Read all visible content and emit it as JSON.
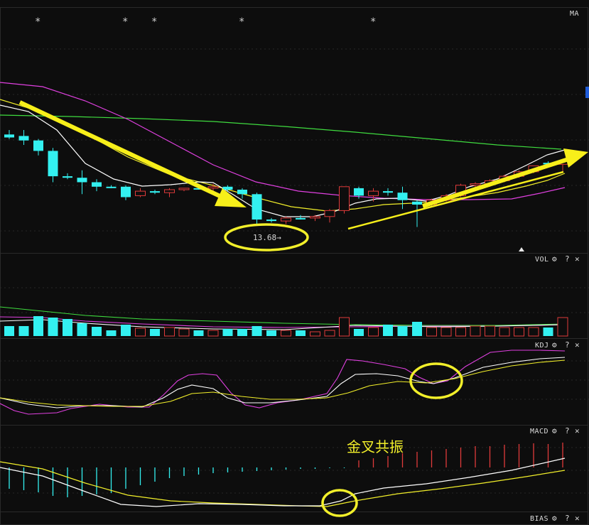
{
  "chart_data": [
    {
      "type": "candlestick",
      "panel": "price",
      "indicator_label": "MA",
      "markers": [
        "*",
        "*",
        "*",
        "*",
        "*"
      ],
      "low_label": "13.68",
      "x": [
        1,
        2,
        3,
        4,
        5,
        6,
        7,
        8,
        9,
        10,
        11,
        12,
        13,
        14,
        15,
        16,
        17,
        18,
        19,
        20,
        21,
        22,
        23,
        24,
        25,
        26,
        27,
        28,
        29,
        30,
        31,
        32,
        33,
        34,
        35,
        36,
        37,
        38,
        39
      ],
      "candles": [
        {
          "o": 33,
          "h": 30,
          "l": 36,
          "c": 35
        },
        {
          "o": 34,
          "h": 30,
          "l": 40,
          "c": 37
        },
        {
          "o": 37,
          "h": 36,
          "l": 47,
          "c": 44
        },
        {
          "o": 44,
          "h": 42,
          "l": 65,
          "c": 61
        },
        {
          "o": 61,
          "h": 59,
          "l": 63,
          "c": 62
        },
        {
          "o": 62,
          "h": 57,
          "l": 73,
          "c": 65
        },
        {
          "o": 65,
          "h": 63,
          "l": 71,
          "c": 68
        },
        {
          "o": 68,
          "h": 67,
          "l": 69,
          "c": 68
        },
        {
          "o": 68,
          "h": 67,
          "l": 77,
          "c": 75
        },
        {
          "o": 74,
          "h": 69,
          "l": 75,
          "c": 71
        },
        {
          "o": 71,
          "h": 70,
          "l": 73,
          "c": 72
        },
        {
          "o": 72,
          "h": 69,
          "l": 75,
          "c": 70
        },
        {
          "o": 70,
          "h": 69,
          "l": 71,
          "c": 69
        },
        {
          "o": 69,
          "h": 68,
          "l": 70,
          "c": 69
        },
        {
          "o": 69,
          "h": 66,
          "l": 71,
          "c": 68
        },
        {
          "o": 68,
          "h": 67,
          "l": 71,
          "c": 70
        },
        {
          "o": 70,
          "h": 69,
          "l": 76,
          "c": 73
        },
        {
          "o": 73,
          "h": 72,
          "l": 93,
          "c": 90
        },
        {
          "o": 90,
          "h": 89,
          "l": 92,
          "c": 91
        },
        {
          "o": 91,
          "h": 88,
          "l": 93,
          "c": 89
        },
        {
          "o": 89,
          "h": 87,
          "l": 90,
          "c": 89
        },
        {
          "o": 89,
          "h": 87,
          "l": 91,
          "c": 88
        },
        {
          "o": 88,
          "h": 83,
          "l": 92,
          "c": 84
        },
        {
          "o": 84,
          "h": 68,
          "l": 86,
          "c": 68
        },
        {
          "o": 69,
          "h": 68,
          "l": 76,
          "c": 74
        },
        {
          "o": 74,
          "h": 69,
          "l": 78,
          "c": 71
        },
        {
          "o": 71,
          "h": 69,
          "l": 74,
          "c": 72
        },
        {
          "o": 72,
          "h": 68,
          "l": 83,
          "c": 77
        },
        {
          "o": 78,
          "h": 77,
          "l": 95,
          "c": 80
        },
        {
          "o": 80,
          "h": 76,
          "l": 81,
          "c": 77
        },
        {
          "o": 77,
          "h": 73,
          "l": 78,
          "c": 74
        },
        {
          "o": 74,
          "h": 66,
          "l": 75,
          "c": 67
        },
        {
          "o": 67,
          "h": 65,
          "l": 69,
          "c": 66
        },
        {
          "o": 66,
          "h": 63,
          "l": 68,
          "c": 64
        },
        {
          "o": 64,
          "h": 60,
          "l": 65,
          "c": 61
        },
        {
          "o": 61,
          "h": 57,
          "l": 62,
          "c": 58
        },
        {
          "o": 58,
          "h": 54,
          "l": 59,
          "c": 54
        },
        {
          "o": 52,
          "h": 51,
          "l": 54,
          "c": 53
        },
        {
          "o": 53,
          "h": 51,
          "l": 58,
          "c": 51
        }
      ],
      "colors": {
        "up": "#e03a3a",
        "down": "#33f0f0",
        "ma5": "#ffffff",
        "ma10": "#f2ef2a",
        "ma20": "#e040e0",
        "ma60": "#3fdc3f",
        "arrow": "#f7ef1a",
        "circle": "#f2ef2a"
      }
    },
    {
      "type": "bar",
      "panel": "volume",
      "indicator_label": "VOL",
      "values": [
        14,
        14,
        28,
        26,
        24,
        18,
        13,
        8,
        16,
        11,
        10,
        12,
        10,
        8,
        8,
        10,
        10,
        14,
        8,
        8,
        8,
        6,
        8,
        26,
        10,
        12,
        16,
        14,
        20,
        12,
        12,
        12,
        14,
        14,
        12,
        12,
        12,
        12,
        26
      ]
    },
    {
      "type": "line",
      "panel": "kdj",
      "indicator_label": "KDJ",
      "x_range": [
        1,
        39
      ]
    },
    {
      "type": "line",
      "panel": "macd",
      "indicator_label": "MACD",
      "annotation": "金叉共振",
      "histogram": [
        -30,
        -32,
        -35,
        -40,
        -42,
        -40,
        -38,
        -36,
        -30,
        -25,
        -20,
        -15,
        -12,
        -10,
        -8,
        -7,
        -6,
        -5,
        -4,
        -3,
        -2,
        -2,
        -1,
        -1,
        10,
        13,
        16,
        20,
        22,
        24,
        26,
        28,
        30,
        30,
        32,
        33,
        34,
        33,
        35
      ]
    },
    {
      "type": "line",
      "panel": "bias",
      "indicator_label": "BIAS"
    }
  ]
}
